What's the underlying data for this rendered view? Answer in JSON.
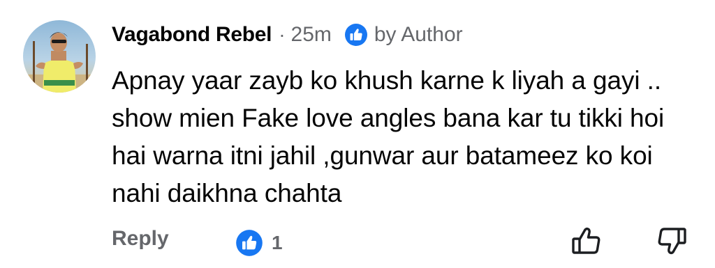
{
  "comment": {
    "author_name": "Vagabond Rebel",
    "separator": "·",
    "time": "25m",
    "liked_by_author_icon": "like-badge-icon",
    "liked_by_label": "by Author",
    "body": "Apnay yaar zayb ko khush karne k liyah a gayi .. show mien Fake love angles bana kar tu tikki hoi hai warna itni jahil ,gunwar aur batameez ko koi nahi daikhna chahta",
    "reply_label": "Reply",
    "reaction_icon": "like-badge-icon",
    "reaction_count": "1",
    "upvote_icon": "thumbs-up-outline-icon",
    "downvote_icon": "thumbs-down-outline-icon"
  },
  "colors": {
    "text_primary": "#050505",
    "text_secondary": "#65676b",
    "like_blue": "#1877f2",
    "background": "#ffffff"
  }
}
